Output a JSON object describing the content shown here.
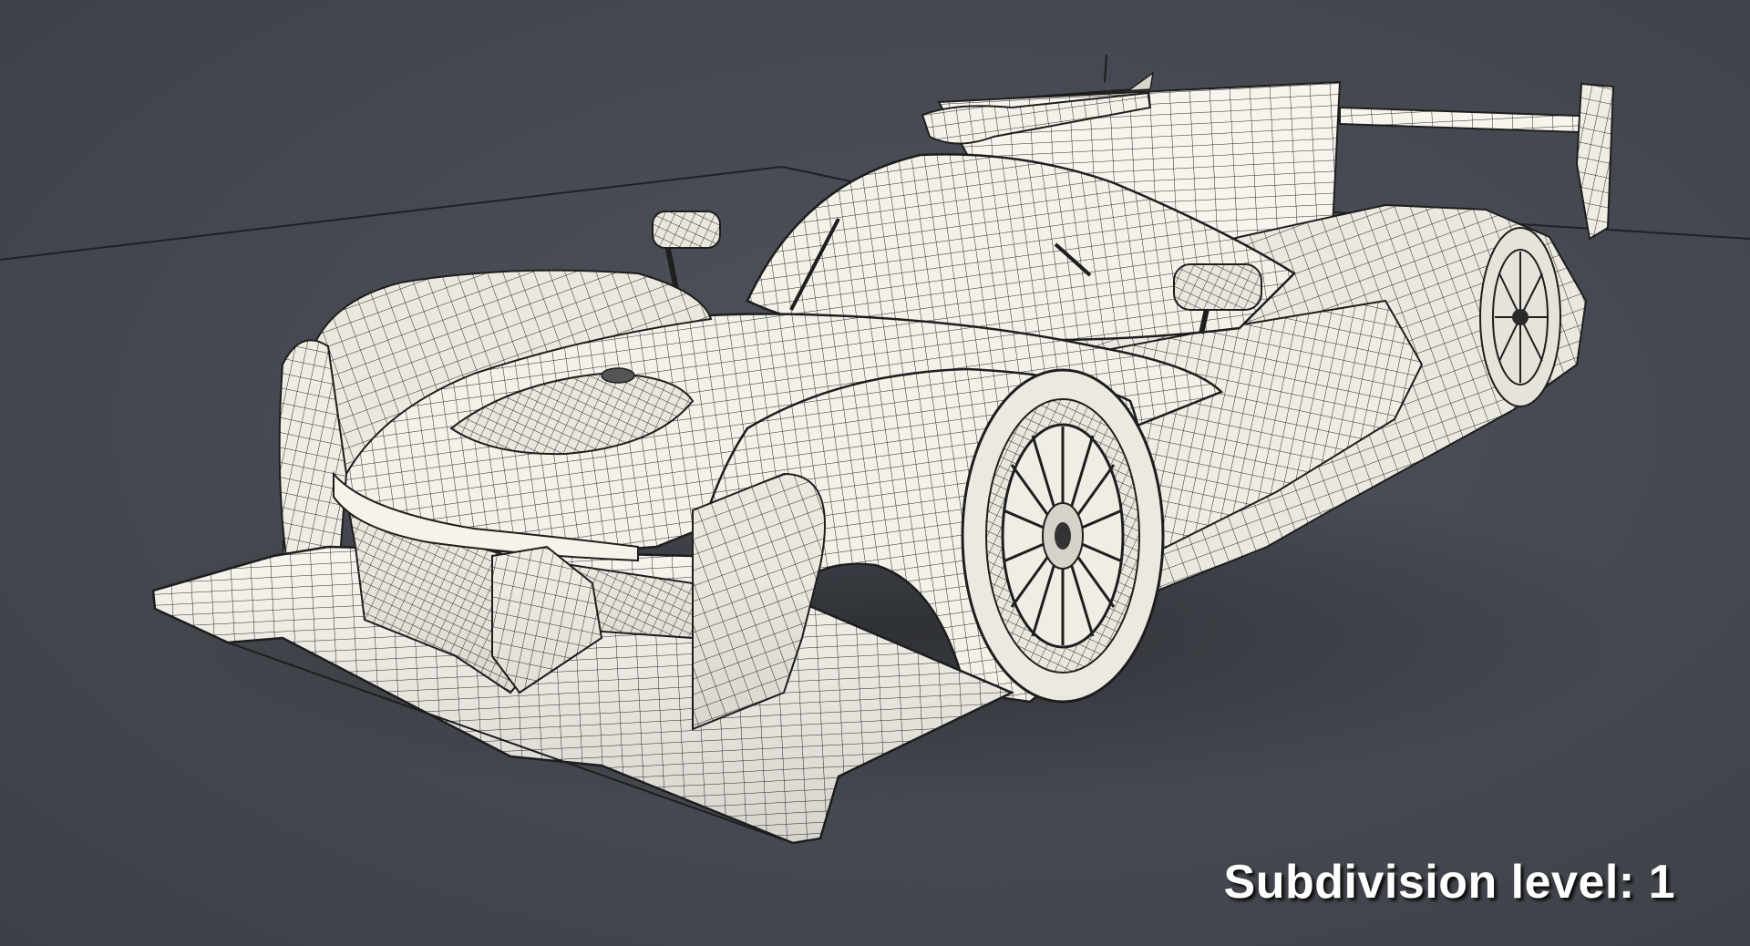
{
  "caption": {
    "text": "Subdivision level: 1"
  },
  "scene": {
    "subject": "race-car-wireframe-render",
    "colors": {
      "background": "#474a51",
      "body_fill": "#f2f0e6",
      "wire": "#2a2a2a",
      "shadow": "#2e3035"
    }
  }
}
